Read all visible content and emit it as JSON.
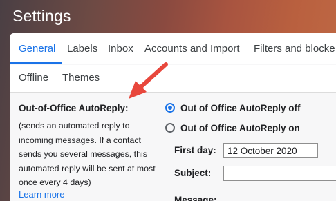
{
  "window": {
    "title": "Settings"
  },
  "tabs_row1": [
    {
      "label": "General",
      "active": true
    },
    {
      "label": "Labels"
    },
    {
      "label": "Inbox"
    },
    {
      "label": "Accounts and Import"
    },
    {
      "label": "Filters and blocke"
    }
  ],
  "tabs_row2": [
    {
      "label": "Offline"
    },
    {
      "label": "Themes"
    }
  ],
  "autoreply": {
    "heading": "Out-of-Office AutoReply:",
    "description_lines": [
      "(sends an automated reply to",
      "incoming messages. If a contact",
      "sends you several messages, this",
      "automated reply will be sent at most",
      "once every 4 days)"
    ],
    "learn_more": "Learn more",
    "option_off": "Out of Office AutoReply off",
    "option_on": "Out of Office AutoReply on",
    "selected": "off",
    "first_day_label": "First day:",
    "first_day_value": "12 October 2020",
    "subject_label": "Subject:",
    "subject_value": "",
    "message_label": "Message:"
  },
  "colors": {
    "accent": "#1a73e8",
    "annotation_arrow": "#e8473c",
    "header_bg": "#8a4a40"
  },
  "icons": [
    "annotation-arrow"
  ]
}
